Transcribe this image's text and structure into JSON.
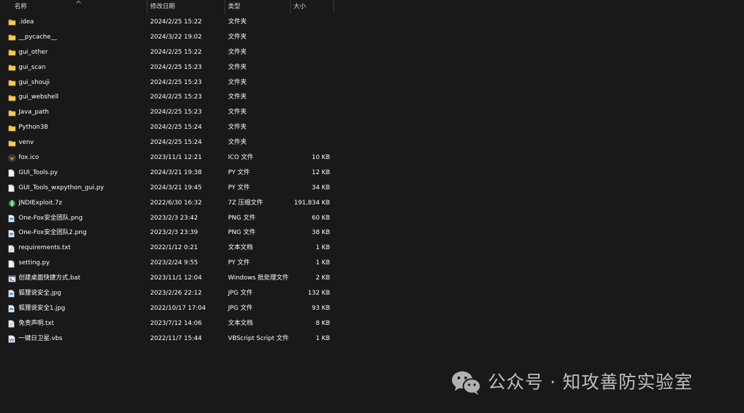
{
  "columns": {
    "name": "名称",
    "date": "修改日期",
    "type": "类型",
    "size": "大小"
  },
  "files": [
    {
      "icon": "folder-icon",
      "name": ".idea",
      "date": "2024/2/25 15:22",
      "type": "文件夹",
      "size": ""
    },
    {
      "icon": "folder-icon",
      "name": "__pycache__",
      "date": "2024/3/22 19:02",
      "type": "文件夹",
      "size": ""
    },
    {
      "icon": "folder-icon",
      "name": "gui_other",
      "date": "2024/2/25 15:22",
      "type": "文件夹",
      "size": ""
    },
    {
      "icon": "folder-icon",
      "name": "gui_scan",
      "date": "2024/2/25 15:23",
      "type": "文件夹",
      "size": ""
    },
    {
      "icon": "folder-icon",
      "name": "gui_shouji",
      "date": "2024/2/25 15:23",
      "type": "文件夹",
      "size": ""
    },
    {
      "icon": "folder-icon",
      "name": "gui_webshell",
      "date": "2024/2/25 15:23",
      "type": "文件夹",
      "size": ""
    },
    {
      "icon": "folder-icon",
      "name": "Java_path",
      "date": "2024/2/25 15:23",
      "type": "文件夹",
      "size": ""
    },
    {
      "icon": "folder-icon",
      "name": "Python38",
      "date": "2024/2/25 15:24",
      "type": "文件夹",
      "size": ""
    },
    {
      "icon": "folder-icon",
      "name": "venv",
      "date": "2024/2/25 15:24",
      "type": "文件夹",
      "size": ""
    },
    {
      "icon": "fox-ico-icon",
      "name": "fox.ico",
      "date": "2023/11/1 12:21",
      "type": "ICO 文件",
      "size": "10 KB"
    },
    {
      "icon": "file-icon",
      "name": "GUI_Tools.py",
      "date": "2024/3/21 19:38",
      "type": "PY 文件",
      "size": "12 KB"
    },
    {
      "icon": "file-icon",
      "name": "GUI_Tools_wxpython_gui.py",
      "date": "2024/3/21 19:45",
      "type": "PY 文件",
      "size": "34 KB"
    },
    {
      "icon": "archive-7z-icon",
      "name": "JNDIExploit.7z",
      "date": "2022/6/30 16:32",
      "type": "7Z 压缩文件",
      "size": "191,834 KB"
    },
    {
      "icon": "image-file-icon",
      "name": "One-Fox安全团队.png",
      "date": "2023/2/3 23:42",
      "type": "PNG 文件",
      "size": "60 KB"
    },
    {
      "icon": "image-file-icon",
      "name": "One-Fox安全团队2.png",
      "date": "2023/2/3 23:39",
      "type": "PNG 文件",
      "size": "38 KB"
    },
    {
      "icon": "text-file-icon",
      "name": "requirements.txt",
      "date": "2022/1/12 0:21",
      "type": "文本文档",
      "size": "1 KB"
    },
    {
      "icon": "file-icon",
      "name": "setting.py",
      "date": "2023/2/24 9:55",
      "type": "PY 文件",
      "size": "1 KB"
    },
    {
      "icon": "batch-file-icon",
      "name": "创建桌面快捷方式.bat",
      "date": "2023/11/1 12:04",
      "type": "Windows 批处理文件",
      "size": "2 KB"
    },
    {
      "icon": "image-file-icon",
      "name": "狐狸说安全.jpg",
      "date": "2023/2/26 22:12",
      "type": "JPG 文件",
      "size": "132 KB"
    },
    {
      "icon": "image-file-icon",
      "name": "狐狸说安全1.jpg",
      "date": "2022/10/17 17:04",
      "type": "JPG 文件",
      "size": "93 KB"
    },
    {
      "icon": "text-file-icon",
      "name": "免责声明.txt",
      "date": "2023/7/12 14:06",
      "type": "文本文档",
      "size": "8 KB"
    },
    {
      "icon": "vbs-script-icon",
      "name": "一键日卫星.vbs",
      "date": "2022/11/7 15:44",
      "type": "VBScript Script 文件",
      "size": "1 KB"
    }
  ],
  "watermark": {
    "icon": "wechat-icon",
    "text": "公众号 · 知攻善防实验室"
  },
  "colors": {
    "background": "#191919",
    "folder": "#f5c242",
    "text": "#ffffff",
    "header_text": "#dcdcdc"
  }
}
